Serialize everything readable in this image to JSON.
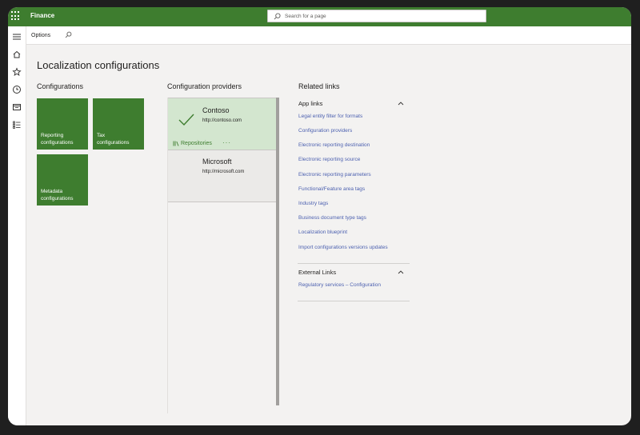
{
  "app": {
    "name": "Finance"
  },
  "search": {
    "placeholder": "Search for a page"
  },
  "actionbar": {
    "options_label": "Options"
  },
  "page": {
    "title": "Localization configurations"
  },
  "configurations": {
    "heading": "Configurations",
    "tiles": [
      {
        "label_line1": "Reporting",
        "label_line2": "configurations"
      },
      {
        "label_line1": "Tax",
        "label_line2": "configurations"
      },
      {
        "label_line1": "Metadata",
        "label_line2": "configurations"
      }
    ]
  },
  "providers": {
    "heading": "Configuration providers",
    "items": [
      {
        "name": "Contoso",
        "url": "http://contoso.com",
        "active": true,
        "repositories_label": "Repositories",
        "more_label": "···"
      },
      {
        "name": "Microsoft",
        "url": "http://microsoft.com",
        "active": false
      }
    ]
  },
  "related": {
    "heading": "Related links",
    "app_links": {
      "heading": "App links",
      "links": [
        "Legal entity filter for formats",
        "Configuration providers",
        "Electronic reporting destination",
        "Electronic reporting source",
        "Electronic reporting parameters",
        "Functional/Feature area tags",
        "Industry tags",
        "Business document type tags",
        "Localization blueprint",
        "Import configurations versions updates"
      ]
    },
    "external_links": {
      "heading": "External Links",
      "links": [
        "Regulatory services – Configuration"
      ]
    }
  },
  "colors": {
    "brand": "#3e7d2f",
    "link": "#4d61b0",
    "selected_provider": "#d3e6cf"
  }
}
